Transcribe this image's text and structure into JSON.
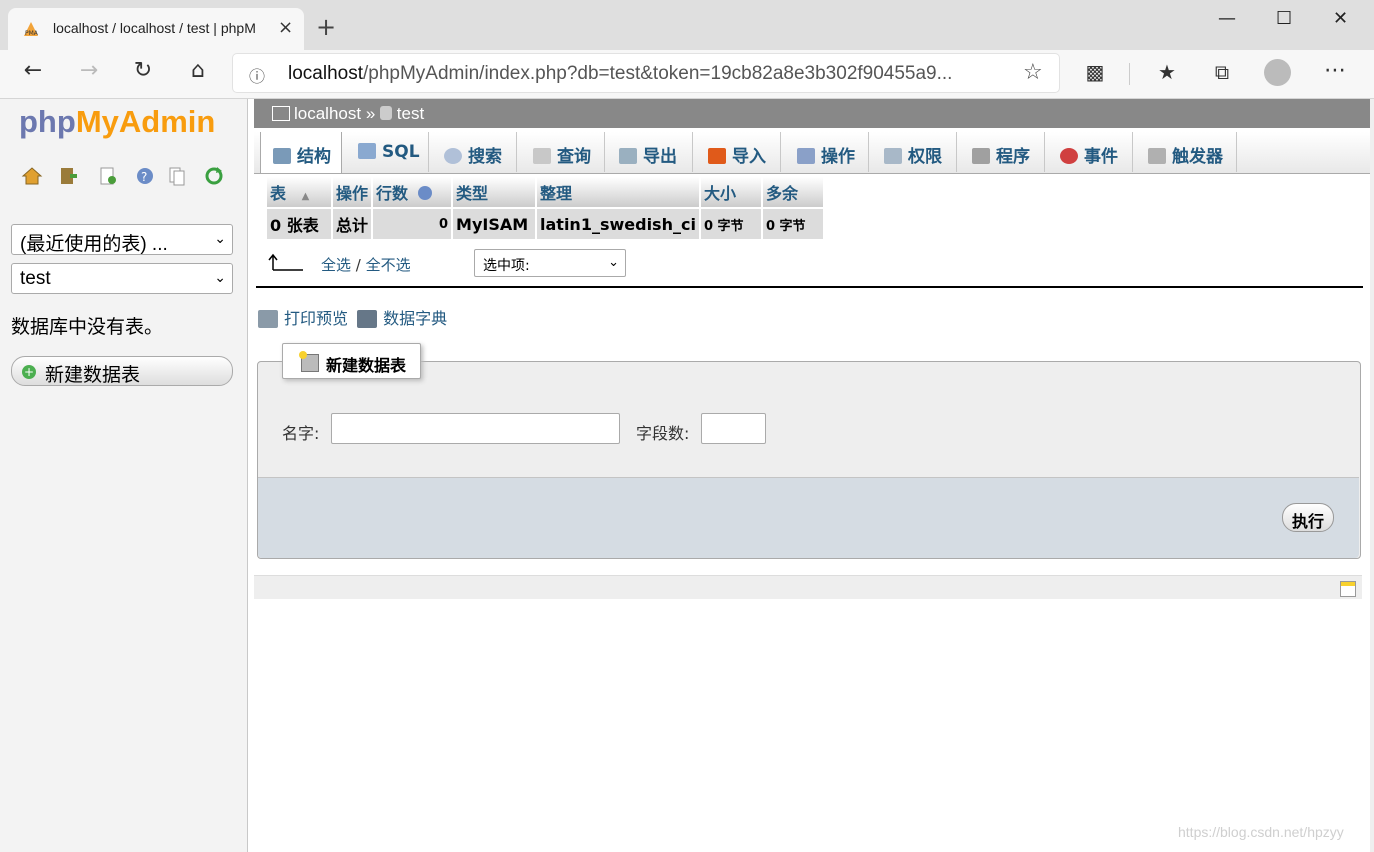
{
  "browser": {
    "tab_title": "localhost / localhost / test | phpM",
    "url_host": "localhost",
    "url_rest": "/phpMyAdmin/index.php?db=test&token=19cb82a8e3b302f90455a9...",
    "new_tab": "+",
    "close_tab": "×",
    "minimize": "—",
    "maximize": "☐",
    "close_window": "✕"
  },
  "sidebar": {
    "logo_php": "php",
    "logo_myadmin": "MyAdmin",
    "recent_tables": "(最近使用的表) ...",
    "database_select": "test",
    "no_tables": "数据库中没有表。",
    "new_table_button": "新建数据表"
  },
  "breadcrumb": {
    "server": "localhost",
    "separator": "»",
    "database": "test"
  },
  "tabs": [
    {
      "label": "结构",
      "icon": "structure-icon"
    },
    {
      "label": "SQL",
      "icon": "sql-icon"
    },
    {
      "label": "搜索",
      "icon": "search-icon"
    },
    {
      "label": "查询",
      "icon": "query-icon"
    },
    {
      "label": "导出",
      "icon": "export-icon"
    },
    {
      "label": "导入",
      "icon": "import-icon"
    },
    {
      "label": "操作",
      "icon": "wrench-icon"
    },
    {
      "label": "权限",
      "icon": "privileges-icon"
    },
    {
      "label": "程序",
      "icon": "routines-icon"
    },
    {
      "label": "事件",
      "icon": "events-icon"
    },
    {
      "label": "触发器",
      "icon": "triggers-icon"
    }
  ],
  "table": {
    "headers": [
      "表",
      "操作",
      "行数",
      "类型",
      "整理",
      "大小",
      "多余"
    ],
    "summary": {
      "tables": "0 张表",
      "total": "总计",
      "rows": "0",
      "type": "MyISAM",
      "collation": "latin1_swedish_ci",
      "size": "0 字节",
      "overhead": "0 字节"
    }
  },
  "selection": {
    "check_all": "全选",
    "separator": "/",
    "uncheck_all": "全不选",
    "with_selected": "选中项:"
  },
  "links": {
    "print_view": "打印预览",
    "data_dictionary": "数据字典"
  },
  "create_table": {
    "legend": "新建数据表",
    "name_label": "名字:",
    "columns_label": "字段数:",
    "go_button": "执行"
  },
  "watermark": "https://blog.csdn.net/hpzyy",
  "colors": {
    "link": "#235a81",
    "highlight": "#ffff4d",
    "breadcrumb_bg": "#888888"
  }
}
